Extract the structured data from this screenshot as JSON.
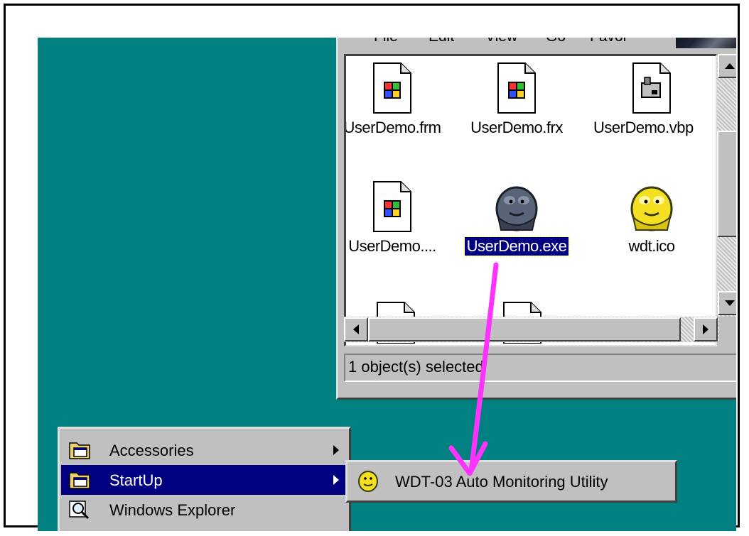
{
  "explorer": {
    "menu": {
      "file": "File",
      "edit": "Edit",
      "view": "View",
      "go": "Go",
      "favorites": "Favor"
    },
    "files": [
      {
        "name": "UserDemo.frm",
        "icon": "vb-form-file-icon",
        "selected": false
      },
      {
        "name": "UserDemo.frx",
        "icon": "vb-form-file-icon",
        "selected": false
      },
      {
        "name": "UserDemo.vbp",
        "icon": "vb-project-file-icon",
        "selected": false
      },
      {
        "name": "UserDemo....",
        "icon": "vb-form-file-icon",
        "selected": false
      },
      {
        "name": "UserDemo.exe",
        "icon": "bulldog-exe-icon",
        "selected": true
      },
      {
        "name": "wdt.ico",
        "icon": "bulldog-ico-icon",
        "selected": false
      }
    ],
    "status": "1 object(s) selected"
  },
  "programs_menu": {
    "items": [
      {
        "label": "Accessories",
        "icon": "program-group-icon",
        "has_submenu": true,
        "active": false
      },
      {
        "label": "StartUp",
        "icon": "program-group-icon",
        "has_submenu": true,
        "active": true
      },
      {
        "label": "Windows Explorer",
        "icon": "explorer-icon",
        "has_submenu": false,
        "active": false
      }
    ]
  },
  "startup_submenu": {
    "items": [
      {
        "label": "WDT-03 Auto Monitoring Utility",
        "icon": "bulldog-app-icon"
      }
    ]
  },
  "colors": {
    "desktop": "#008080",
    "selection": "#000080",
    "drag_arrow": "#ff33ff",
    "window_face": "#c0c0c0"
  }
}
